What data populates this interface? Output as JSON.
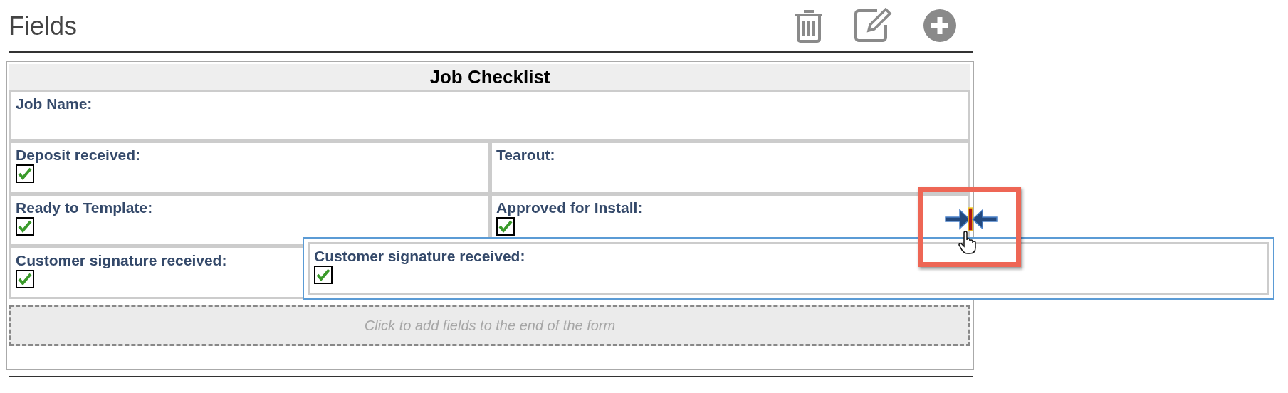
{
  "header": {
    "title": "Fields"
  },
  "form": {
    "title": "Job Checklist",
    "rows": [
      [
        {
          "label": "Job Name:",
          "kind": "text"
        }
      ],
      [
        {
          "label": "Deposit received:",
          "kind": "checkbox",
          "checked": true
        },
        {
          "label": "Tearout:",
          "kind": "text"
        }
      ],
      [
        {
          "label": "Ready to Template:",
          "kind": "checkbox",
          "checked": true
        },
        {
          "label": "Approved for Install:",
          "kind": "checkbox",
          "checked": true
        }
      ],
      [
        {
          "label": "Customer signature received:",
          "kind": "checkbox",
          "checked": true
        }
      ]
    ],
    "add_fields": "Click to add fields to the end of the form"
  },
  "dragged_field": {
    "label": "Customer signature received:",
    "kind": "checkbox",
    "checked": true
  }
}
